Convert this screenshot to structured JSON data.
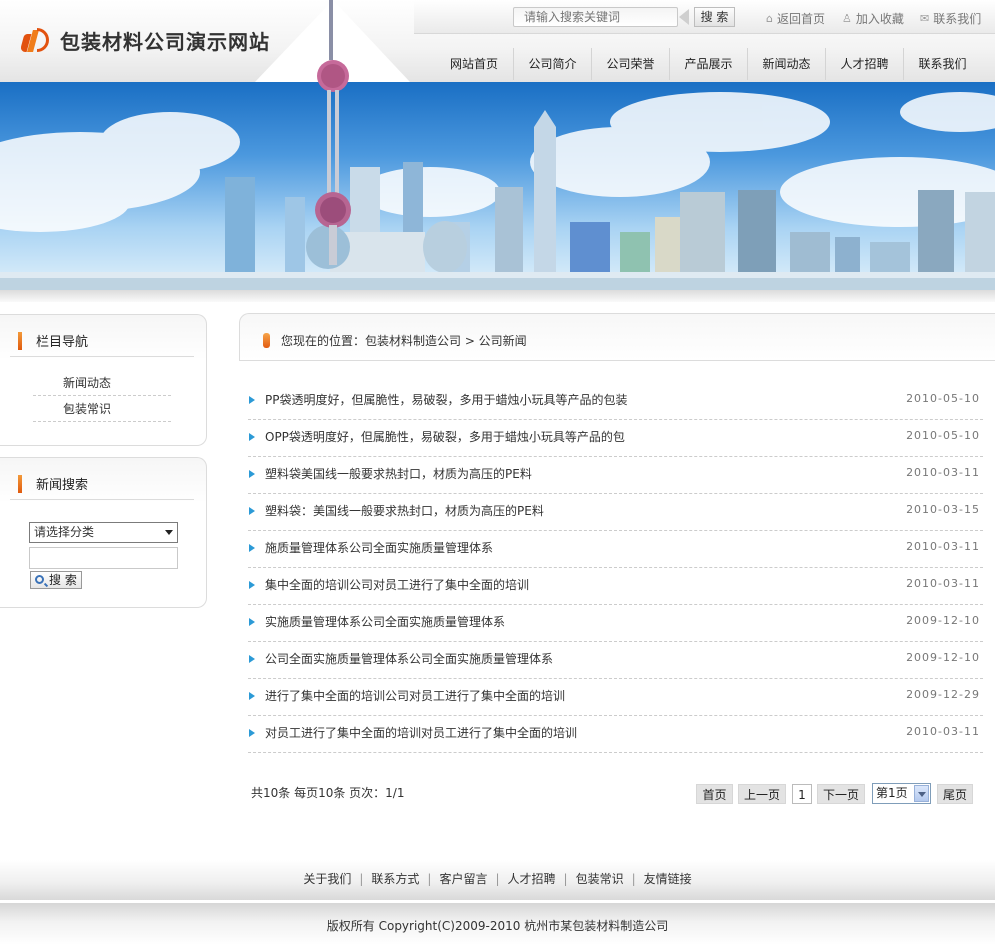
{
  "header": {
    "site_title": "包装材料公司演示网站",
    "search_placeholder": "请输入搜索关键词",
    "search_button": "搜 索",
    "top_links": [
      {
        "label": "返回首页",
        "icon": "home-icon"
      },
      {
        "label": "加入收藏",
        "icon": "favorite-icon"
      },
      {
        "label": "联系我们",
        "icon": "contact-icon"
      }
    ]
  },
  "nav": {
    "items": [
      "网站首页",
      "公司简介",
      "公司荣誉",
      "产品展示",
      "新闻动态",
      "人才招聘",
      "联系我们"
    ]
  },
  "sidebar": {
    "nav_title": "栏目导航",
    "nav_links": [
      "新闻动态",
      "包装常识"
    ],
    "search_title": "新闻搜索",
    "category_select": "请选择分类",
    "search_button": "搜 索"
  },
  "main": {
    "breadcrumb": "您现在的位置：包装材料制造公司  > 公司新闻",
    "news": [
      {
        "title": "PP袋透明度好，但属脆性，易破裂，多用于蜡烛小玩具等产品的包装",
        "date": "2010-05-10"
      },
      {
        "title": "OPP袋透明度好，但属脆性，易破裂，多用于蜡烛小玩具等产品的包",
        "date": "2010-05-10"
      },
      {
        "title": "塑料袋美国线一般要求热封口，材质为高压的PE料",
        "date": "2010-03-11"
      },
      {
        "title": "塑料袋：美国线一般要求热封口，材质为高压的PE料",
        "date": "2010-03-15"
      },
      {
        "title": "施质量管理体系公司全面实施质量管理体系",
        "date": "2010-03-11"
      },
      {
        "title": "集中全面的培训公司对员工进行了集中全面的培训",
        "date": "2010-03-11"
      },
      {
        "title": "实施质量管理体系公司全面实施质量管理体系",
        "date": "2009-12-10"
      },
      {
        "title": "公司全面实施质量管理体系公司全面实施质量管理体系",
        "date": "2009-12-10"
      },
      {
        "title": "进行了集中全面的培训公司对员工进行了集中全面的培训",
        "date": "2009-12-29"
      },
      {
        "title": "对员工进行了集中全面的培训对员工进行了集中全面的培训",
        "date": "2010-03-11"
      }
    ],
    "pagination": {
      "info": "共10条  每页10条  页次：1/1",
      "first": "首页",
      "prev": "上一页",
      "current": "1",
      "next": "下一页",
      "page_select": "第1页",
      "last": "尾页"
    }
  },
  "footer": {
    "links": [
      "关于我们",
      "联系方式",
      "客户留言",
      "人才招聘",
      "包装常识",
      "友情链接"
    ],
    "copyright": "版权所有  Copyright(C)2009-2010 杭州市某包装材料制造公司"
  },
  "colors": {
    "accent_orange": "#e2520f",
    "bullet_blue": "#2c9ad6",
    "sky_blue": "#4b98de"
  }
}
